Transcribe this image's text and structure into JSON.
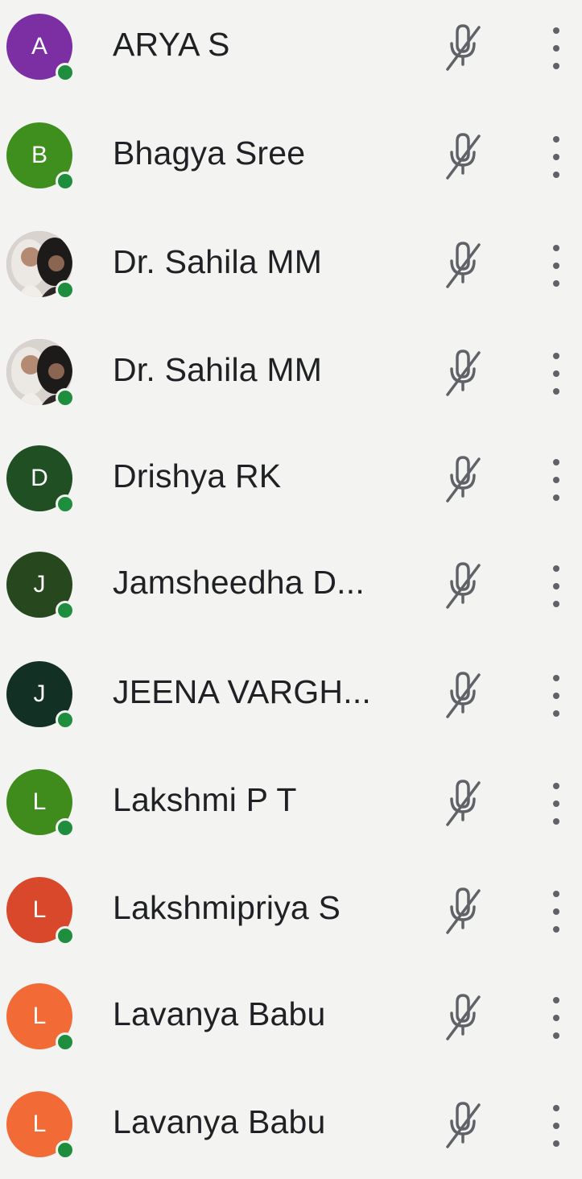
{
  "participants": [
    {
      "initial": "A",
      "name": "ARYA S",
      "color": "#7b2fa3",
      "photo": false
    },
    {
      "initial": "B",
      "name": "Bhagya Sree",
      "color": "#3f8f1f",
      "photo": false
    },
    {
      "initial": "",
      "name": "Dr. Sahila MM",
      "color": "#9a8c86",
      "photo": true
    },
    {
      "initial": "",
      "name": "Dr. Sahila MM",
      "color": "#9a8c86",
      "photo": true
    },
    {
      "initial": "D",
      "name": "Drishya RK",
      "color": "#1f4f22",
      "photo": false
    },
    {
      "initial": "J",
      "name": "Jamsheedha D...",
      "color": "#27471e",
      "photo": false
    },
    {
      "initial": "J",
      "name": "JEENA VARGH...",
      "color": "#123024",
      "photo": false
    },
    {
      "initial": "L",
      "name": "Lakshmi P T",
      "color": "#3f8c1d",
      "photo": false
    },
    {
      "initial": "L",
      "name": "Lakshmipriya S",
      "color": "#d9482a",
      "photo": false
    },
    {
      "initial": "L",
      "name": "Lavanya Babu",
      "color": "#f26a35",
      "photo": false
    },
    {
      "initial": "L",
      "name": "Lavanya Babu",
      "color": "#f26a35",
      "photo": false
    }
  ],
  "icons": {
    "status": "online-dot-icon",
    "mic": "mic-off-icon",
    "menu": "more-vert-icon"
  },
  "colors": {
    "text": "#202124",
    "icon": "#5f6368",
    "online": "#1e8e3e",
    "background": "#f3f3f1"
  }
}
